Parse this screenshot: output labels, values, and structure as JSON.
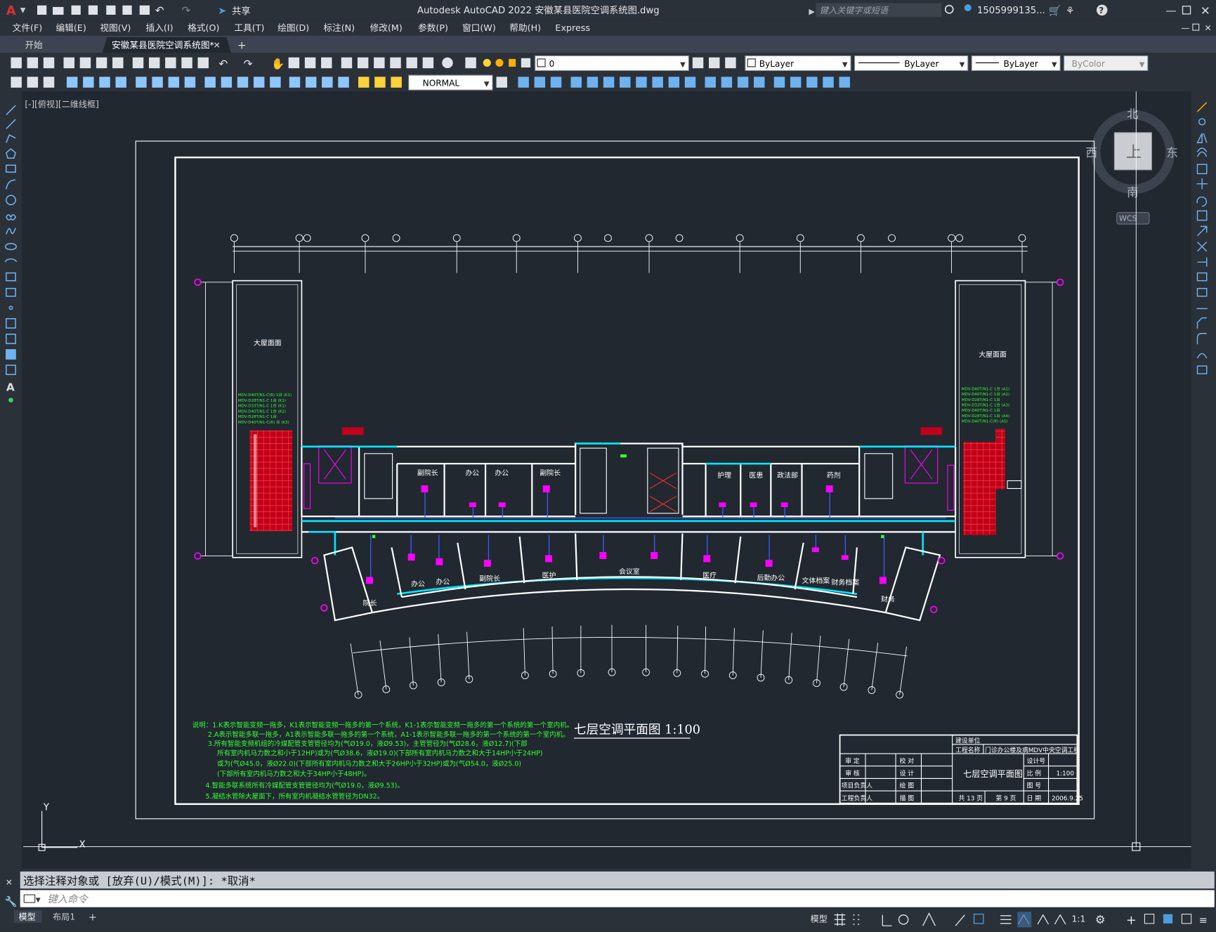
{
  "app": {
    "logo": "A",
    "share": "共享",
    "title": "Autodesk AutoCAD 2022    安徽某县医院空调系统图.dwg",
    "search_placeholder": "键入关键字或短语",
    "user": "1505999135..."
  },
  "menu": [
    "文件(F)",
    "编辑(E)",
    "视图(V)",
    "插入(I)",
    "格式(O)",
    "工具(T)",
    "绘图(D)",
    "标注(N)",
    "修改(M)",
    "参数(P)",
    "窗口(W)",
    "帮助(H)",
    "Express"
  ],
  "tabs": [
    {
      "label": "开始",
      "active": false
    },
    {
      "label": "安徽某县医院空调系统图*",
      "active": true
    }
  ],
  "props": {
    "layer": "0",
    "color": "ByLayer",
    "linetype": "ByLayer",
    "lineweight": "ByLayer",
    "plotstyle": "ByColor",
    "textstyle": "NORMAL"
  },
  "viewport_label": "[-][俯视][二维线框]",
  "viewcube": {
    "north": "北",
    "south": "南",
    "east": "东",
    "west": "西",
    "top": "上",
    "wcs": "WCS"
  },
  "drawing": {
    "title": "七层空调平面图 1:100",
    "left_stair_label": "大屋面面",
    "right_stair_label": "大屋面面",
    "rooms_top": [
      "副院长",
      "办公",
      "办公",
      "副院长",
      "护理",
      "医患",
      "政法部",
      "药剂"
    ],
    "rooms_bottom": [
      "院长",
      "办公",
      "办公",
      "副院长",
      "医护",
      "会议室",
      "医疗",
      "后勤办公",
      "文体档案",
      "财务档案",
      "财务"
    ],
    "notes": [
      "说明：1.K表示智能变频一拖多，K1表示智能变频一拖多的第一个系统，K1-1表示智能变频一拖多的第一个系统的第一个室内机。",
      "2.A表示智能多联一拖多，A1表示智能多联一拖多的第一个系统，A1-1表示智能多联一拖多的第一个系统的第一个室内机。",
      "3.所有智能变频机组的冷媒配管支管管径均为(气Ø19.0，液Ø9.53)，主管管径为(气Ø28.6，液Ø12.7)(下部",
      "所有室内机马力数之和小于12HP)或为(气Ø38.6，液Ø19.0)(下部所有室内机马力数之和大于14HP小于24HP)",
      "或为(气Ø45.0，液Ø22.0)(下部所有室内机马力数之和大于26HP小于32HP)或为(气Ø54.0，液Ø25.0)",
      "(下部所有室内机马力数之和大于34HP小于48HP)。",
      "4.智能多联系统所有冷媒配管支管管径均为(气Ø19.0，液Ø9.53)。",
      "5.凝结水管除大屋面下，所有室内机凝结水管管径为DN32。"
    ],
    "title_block": {
      "unit_label": "建设单位",
      "project_label": "工程名称",
      "project": "门诊办公楼及病MDV中央空调工程",
      "drawing_name": "七层空调平面图",
      "scale": "1:100",
      "date": "2006.9.25",
      "total_pages": "共 13 页",
      "page": "第 9 页",
      "rows_left": [
        "审 定",
        "审 核",
        "项目负责人",
        "工程负责人"
      ],
      "rows_mid": [
        "校 对",
        "设 计",
        "绘 图",
        "描 图"
      ],
      "rows_right": [
        "设计号",
        "比 例",
        "图 号",
        "日 期"
      ]
    }
  },
  "command": {
    "history": "选择注释对象或 [放弃(U)/模式(M)]: *取消*",
    "placeholder": "键入命令"
  },
  "layout_tabs": [
    {
      "label": "模型",
      "active": true
    },
    {
      "label": "布局1",
      "active": false
    }
  ],
  "status": {
    "model": "模型",
    "scale": "1:1"
  },
  "colors": {
    "accent": "#4a9de0",
    "wall": "#ffffff",
    "duct": "#00e5ff",
    "unit": "#ff00ff",
    "equipment": "#ff1a1a",
    "note": "#33ff33"
  }
}
